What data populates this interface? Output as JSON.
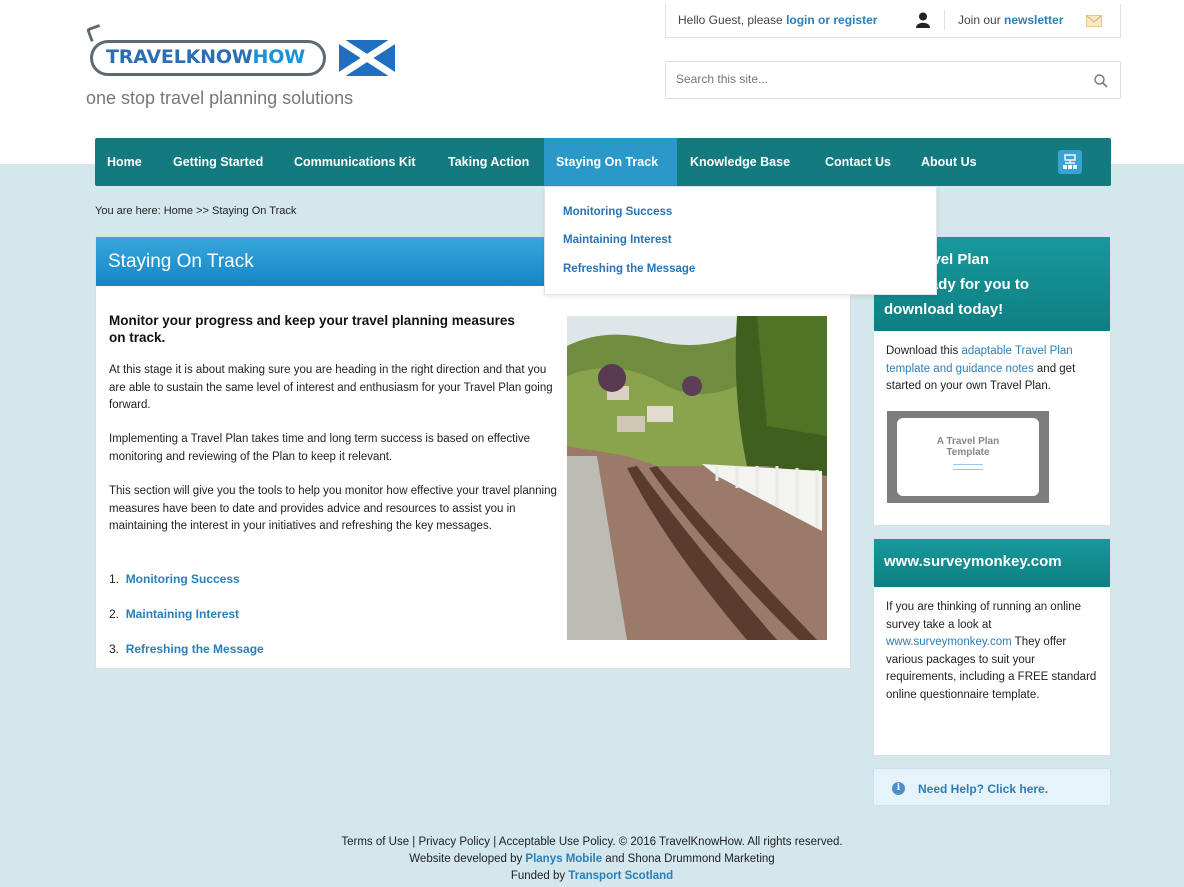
{
  "header": {
    "logo_text_1": "TRAVEL",
    "logo_text_2": "KNOW",
    "logo_text_3": "HOW",
    "tagline": "one stop travel planning solutions",
    "greeting": "Hello Guest, please ",
    "login_link": "login or register",
    "newsletter_prefix": "Join our ",
    "newsletter_link": "newsletter",
    "search_placeholder": "Search this site..."
  },
  "nav": {
    "items": [
      {
        "label": "Home"
      },
      {
        "label": "Getting Started"
      },
      {
        "label": "Communications Kit"
      },
      {
        "label": "Taking Action"
      },
      {
        "label": "Staying On Track",
        "active": true
      },
      {
        "label": "Knowledge Base"
      },
      {
        "label": "Contact Us"
      },
      {
        "label": "About Us"
      }
    ],
    "dropdown": [
      "Monitoring Success",
      "Maintaining Interest",
      "Refreshing the Message"
    ]
  },
  "breadcrumb": "You are here: Home >> Staying On Track",
  "main": {
    "title": "Staying On Track",
    "lead": "Monitor your progress and keep your travel planning measures on track.",
    "para1": "At this stage it is about making sure you are heading in the right direction and that you are able to sustain the same level of interest and enthusiasm for your Travel Plan going forward.",
    "para2": "Implementing a Travel Plan takes time and long term success is based on effective monitoring and reviewing of the Plan to keep it relevant.",
    "para3": "This section will give you the tools to help you monitor how effective your travel planning measures have been to date and provides advice and resources to assist you in maintaining the interest in your initiatives and refreshing the key messages.",
    "links": [
      {
        "num": "1.",
        "label": "Monitoring Success"
      },
      {
        "num": "2.",
        "label": "Maintaining Interest"
      },
      {
        "num": "3.",
        "label": "Refreshing the Message"
      }
    ]
  },
  "sidebar": {
    "box1": {
      "title_lines": [
        "ble Travel Plan",
        "te - Ready for you to",
        "download today!"
      ],
      "text_before": "Download this ",
      "link": "adaptable Travel Plan template and guidance notes",
      "text_after": " and get started on your own Travel Plan.",
      "thumb_text": "A Travel Plan Template"
    },
    "box2": {
      "title": "www.surveymonkey.com",
      "text_before": "If you are thinking of running an online survey take a look at ",
      "link": "www.surveymonkey.com",
      "text_after": "  They offer various packages to suit your requirements, including a FREE standard online questionnaire template."
    },
    "help": "Need Help? Click here."
  },
  "footer": {
    "line1": "Terms of Use | Privacy Policy | Acceptable Use Policy. © 2016 TravelKnowHow. All rights reserved.",
    "line2_prefix": "Website developed by ",
    "line2_link": "Planys Mobile",
    "line2_suffix": " and Shona Drummond Marketing",
    "line3_prefix": "Funded by ",
    "line3_link": "Transport Scotland"
  },
  "colors": {
    "nav_bg": "#137a80",
    "nav_active": "#2a98c8",
    "link": "#2b7fb8",
    "band": "#d3e7ec"
  }
}
